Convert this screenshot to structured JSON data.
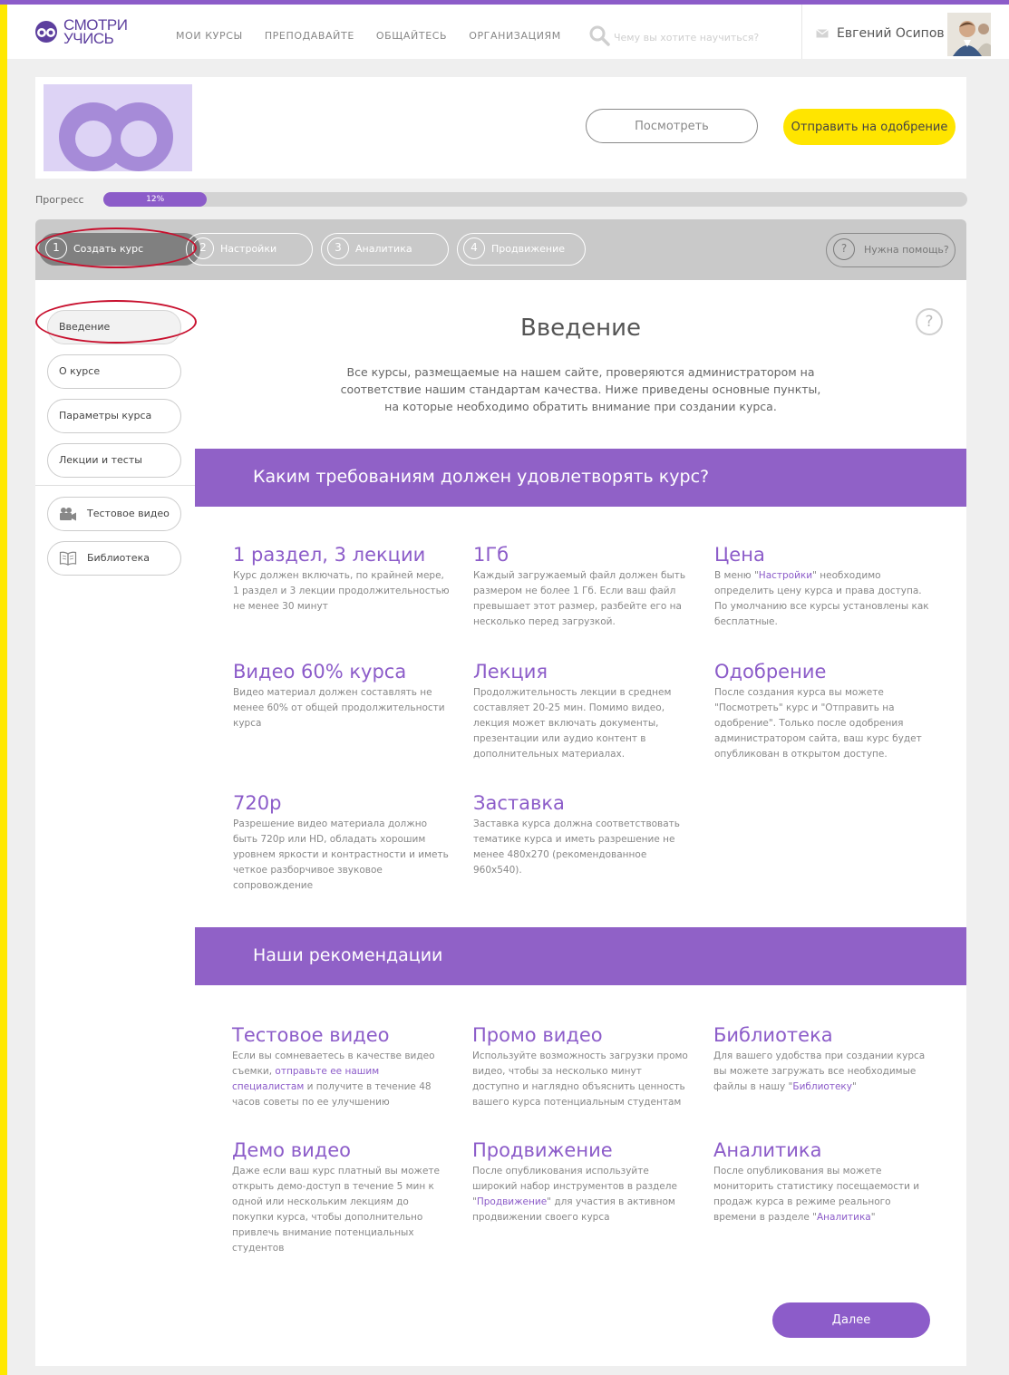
{
  "header": {
    "logo_top": "СМОТРИ",
    "logo_bottom": "УЧИСЬ",
    "nav": [
      "МОИ КУРСЫ",
      "ПРЕПОДАВАЙТЕ",
      "ОБЩАЙТЕСЬ",
      "ОРГАНИЗАЦИЯМ"
    ],
    "search_placeholder": "Чему вы хотите научиться?",
    "user_name": "Евгений Осипов"
  },
  "course_card": {
    "preview_label": "Посмотреть",
    "submit_label": "Отправить на одобрение"
  },
  "progress": {
    "label": "Прогресс",
    "value_text": "12%",
    "fraction": 0.12
  },
  "steps": {
    "items": [
      {
        "num": "1",
        "label": "Создать курс"
      },
      {
        "num": "2",
        "label": "Настройки"
      },
      {
        "num": "3",
        "label": "Аналитика"
      },
      {
        "num": "4",
        "label": "Продвижение"
      }
    ],
    "active_index": 0,
    "help": {
      "mark": "?",
      "label": "Нужна помощь?"
    }
  },
  "sidebar": {
    "items": [
      "Введение",
      "О курсе",
      "Параметры курса",
      "Лекции и тесты"
    ],
    "tools": [
      {
        "label": "Тестовое видео",
        "icon": "video-camera-icon"
      },
      {
        "label": "Библиотека",
        "icon": "book-icon"
      }
    ]
  },
  "main": {
    "help_mark": "?",
    "title": "Введение",
    "intro": "Все курсы, размещаемые на нашем сайте, проверяются администратором на соответствие нашим стандартам качества. Ниже приведены основные пункты, на которые необходимо обратить внимание при создании курса.",
    "requirements": {
      "title": "Каким требованиям должен удовлетворять курс?",
      "items": [
        {
          "title": "1 раздел, 3 лекции",
          "text": "Курс должен включать, по крайней мере, 1 раздел и 3 лекции продолжительностью не менее 30 минут"
        },
        {
          "title": "1Гб",
          "text": "Каждый загружаемый файл должен быть размером не более 1 Гб. Если ваш файл превышает этот размер, разбейте его на несколько перед загрузкой."
        },
        {
          "title": "Цена",
          "text_before": "В меню \"",
          "link": "Настройки",
          "text_after": "\" необходимо определить цену курса и права доступа. По умолчанию все курсы установлены как бесплатные."
        },
        {
          "title": "Видео 60% курса",
          "text": "Видео материал должен составлять не менее 60% от общей продолжительности курса"
        },
        {
          "title": "Лекция",
          "text": "Продолжительность лекции в среднем составляет 20-25 мин. Помимо видео, лекция может включать документы, презентации или аудио контент в дополнительных материалах."
        },
        {
          "title": "Одобрение",
          "text": "После создания курса вы можете \"Посмотреть\" курс и \"Отправить на одобрение\". Только после одобрения администратором сайта, ваш курс будет опубликован в открытом доступе."
        },
        {
          "title": "720p",
          "text": "Разрешение видео материала должно быть 720p или HD, обладать хорошим уровнем яркости и контрастности и иметь четкое разборчивое звуковое сопровождение"
        },
        {
          "title": "Заставка",
          "text": "Заставка курса должна соответствовать тематике курса и иметь разрешение не менее 480x270 (рекомендованное 960x540)."
        }
      ]
    },
    "recommendations": {
      "title": "Наши рекомендации",
      "items": [
        {
          "title": "Тестовое видео",
          "text_before": "Если вы сомневаетесь в качестве видео съемки, ",
          "link": "отправьте ее нашим специалистам",
          "text_after": " и получите в течение 48 часов советы по ее улучшению"
        },
        {
          "title": "Промо видео",
          "text": "Используйте возможность загрузки промо видео, чтобы за несколько минут доступно и наглядно объяснить ценность вашего курса потенциальным студентам"
        },
        {
          "title": "Библиотека",
          "text_before": "Для вашего удобства при создании курса вы можете загружать все необходимые файлы в нашу \"",
          "link": "Библиотеку",
          "text_after": "\""
        },
        {
          "title": "Демо видео",
          "text": "Даже если ваш курс платный вы можете открыть демо-доступ в течение 5 мин к одной или нескольким лекциям до покупки курса, чтобы дополнительно привлечь внимание потенциальных студентов"
        },
        {
          "title": "Продвижение",
          "text_before": "После опубликования используйте широкий набор инструментов в разделе \"",
          "link": "Продвижение",
          "text_after": "\" для участия в активном продвижении своего курса"
        },
        {
          "title": "Аналитика",
          "text_before": "После опубликования вы можете мониторить статистику посещаемости и продаж курса в режиме реального времени в разделе \"",
          "link": "Аналитика",
          "text_after": "\""
        }
      ]
    },
    "next_label": "Далее"
  },
  "colors": {
    "accent_purple": "#8c5cc9",
    "yellow": "#ffe500",
    "annotation_red": "#c8102e"
  }
}
